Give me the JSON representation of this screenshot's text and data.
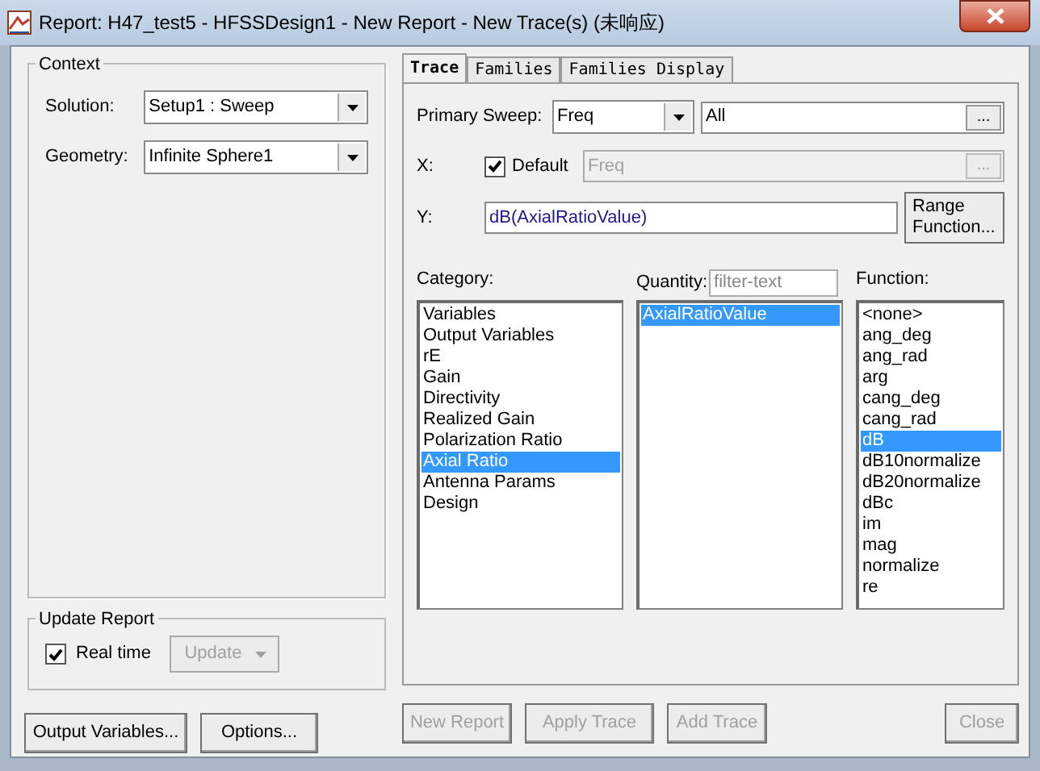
{
  "window": {
    "title": "Report: H47_test5 - HFSSDesign1 - New Report - New Trace(s) (未响应)"
  },
  "context": {
    "title": "Context",
    "fields": [
      {
        "label": "Solution:",
        "value": "Setup1 : Sweep"
      },
      {
        "label": "Geometry:",
        "value": "Infinite Sphere1"
      }
    ]
  },
  "update_report": {
    "title": "Update Report",
    "real_time": {
      "label": "Real time",
      "checked": true
    },
    "update_button": {
      "label": "Update",
      "disabled": true
    }
  },
  "left_buttons": [
    "Output Variables...",
    "Options..."
  ],
  "tabs": [
    {
      "label": "Trace",
      "selected": true
    },
    {
      "label": "Families",
      "selected": false
    },
    {
      "label": "Families Display",
      "selected": false
    }
  ],
  "primary_sweep": {
    "label": "Primary Sweep:",
    "value": "Freq",
    "range": "All",
    "browse": "..."
  },
  "x": {
    "label": "X:",
    "default": {
      "label": "Default",
      "checked": true
    },
    "value": "Freq",
    "browse": "..."
  },
  "y": {
    "label": "Y:",
    "value": "dB(AxialRatioValue)",
    "range_button": "Range\nFunction..."
  },
  "category": {
    "label": "Category:",
    "items": [
      {
        "label": "Variables",
        "selected": false
      },
      {
        "label": "Output Variables",
        "selected": false
      },
      {
        "label": "rE",
        "selected": false
      },
      {
        "label": "Gain",
        "selected": false
      },
      {
        "label": "Directivity",
        "selected": false
      },
      {
        "label": "Realized Gain",
        "selected": false
      },
      {
        "label": "Polarization Ratio",
        "selected": false
      },
      {
        "label": "Axial Ratio",
        "selected": true
      },
      {
        "label": "Antenna Params",
        "selected": false
      },
      {
        "label": "Design",
        "selected": false
      }
    ]
  },
  "quantity": {
    "label": "Quantity:",
    "placeholder": "filter-text",
    "items": [
      {
        "label": "AxialRatioValue",
        "selected": true
      }
    ]
  },
  "function": {
    "label": "Function:",
    "items": [
      {
        "label": "<none>",
        "selected": false
      },
      {
        "label": "ang_deg",
        "selected": false
      },
      {
        "label": "ang_rad",
        "selected": false
      },
      {
        "label": "arg",
        "selected": false
      },
      {
        "label": "cang_deg",
        "selected": false
      },
      {
        "label": "cang_rad",
        "selected": false
      },
      {
        "label": "dB",
        "selected": true
      },
      {
        "label": "dB10normalize",
        "selected": false
      },
      {
        "label": "dB20normalize",
        "selected": false
      },
      {
        "label": "dBc",
        "selected": false
      },
      {
        "label": "im",
        "selected": false
      },
      {
        "label": "mag",
        "selected": false
      },
      {
        "label": "normalize",
        "selected": false
      },
      {
        "label": "re",
        "selected": false
      }
    ]
  },
  "bottom_buttons": [
    {
      "label": "New Report",
      "disabled": true
    },
    {
      "label": "Apply Trace",
      "disabled": true
    },
    {
      "label": "Add Trace",
      "disabled": true
    },
    {
      "label": "Close",
      "disabled": true
    }
  ]
}
